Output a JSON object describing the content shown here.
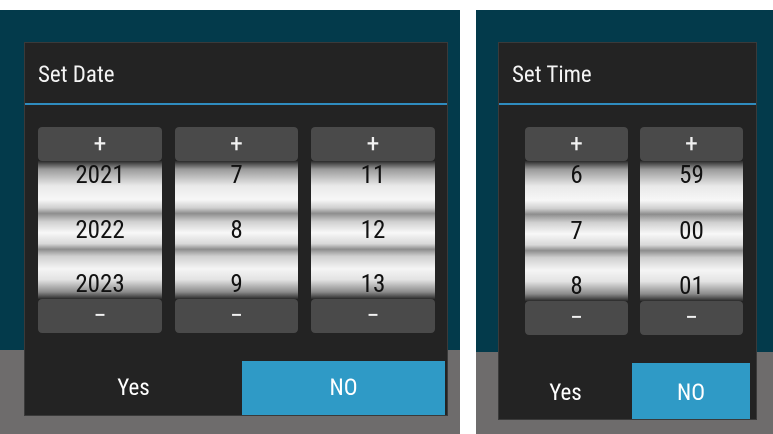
{
  "date_dialog": {
    "title": "Set Date",
    "spinners": [
      {
        "plus": "+",
        "minus": "−",
        "values": [
          "2021",
          "2022",
          "2023"
        ]
      },
      {
        "plus": "+",
        "minus": "−",
        "values": [
          "7",
          "8",
          "9"
        ]
      },
      {
        "plus": "+",
        "minus": "−",
        "values": [
          "11",
          "12",
          "13"
        ]
      }
    ],
    "yes_label": "Yes",
    "no_label": "NO"
  },
  "time_dialog": {
    "title": "Set Time",
    "spinners": [
      {
        "plus": "+",
        "minus": "−",
        "values": [
          "6",
          "7",
          "8"
        ]
      },
      {
        "plus": "+",
        "minus": "−",
        "values": [
          "59",
          "00",
          "01"
        ]
      }
    ],
    "yes_label": "Yes",
    "no_label": "NO"
  },
  "colors": {
    "background_teal": "#033a4b",
    "background_grey": "#6e6c6c",
    "dialog": "#232323",
    "accent": "#2f9ac6",
    "spinner_button": "#4a4a4a"
  }
}
